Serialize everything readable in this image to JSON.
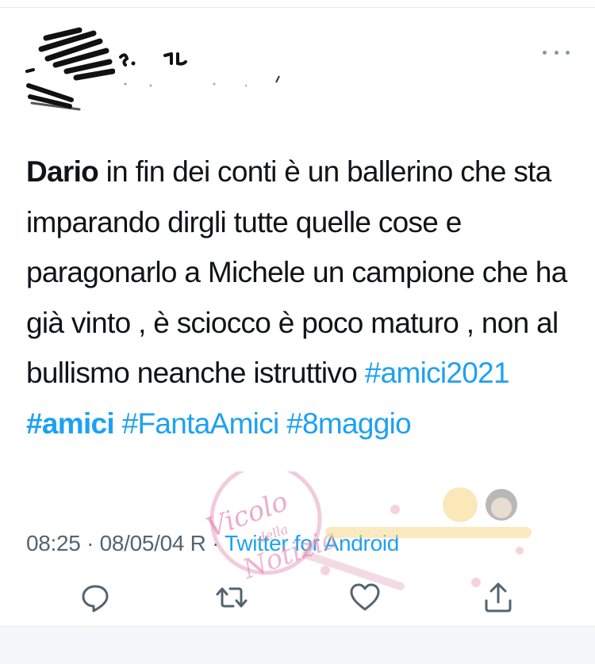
{
  "tweet": {
    "text_segments": [
      {
        "text": "Dario",
        "style": "bold"
      },
      {
        "text": " in fin dei conti è un ballerino che sta imparando dirgli tutte quelle cose e paragonarlo a Michele un campione che ha già vinto , è sciocco è poco maturo , non al bullismo neanche istruttivo ",
        "style": "plain"
      },
      {
        "text": "#amici2021",
        "style": "hashtag"
      },
      {
        "text": " ",
        "style": "plain"
      },
      {
        "text": "#amici",
        "style": "hashtag-bold"
      },
      {
        "text": " ",
        "style": "plain"
      },
      {
        "text": "#FantaAmici",
        "style": "hashtag"
      },
      {
        "text": " ",
        "style": "plain"
      },
      {
        "text": "#8maggio",
        "style": "hashtag"
      }
    ],
    "time": "08:25",
    "separator": "·",
    "date": "08/05/04",
    "date_suffix": "R",
    "source": "Twitter for Android"
  },
  "watermark": {
    "line1": "Vicolo",
    "line2": "della",
    "line3": "Notizia"
  },
  "icons": {
    "more": "more-dots-icon",
    "reply": "reply-icon",
    "retweet": "retweet-icon",
    "like": "heart-icon",
    "share": "share-icon"
  },
  "colors": {
    "text": "#0f1419",
    "muted": "#536471",
    "link": "#1da1f2",
    "icon": "#536471"
  }
}
